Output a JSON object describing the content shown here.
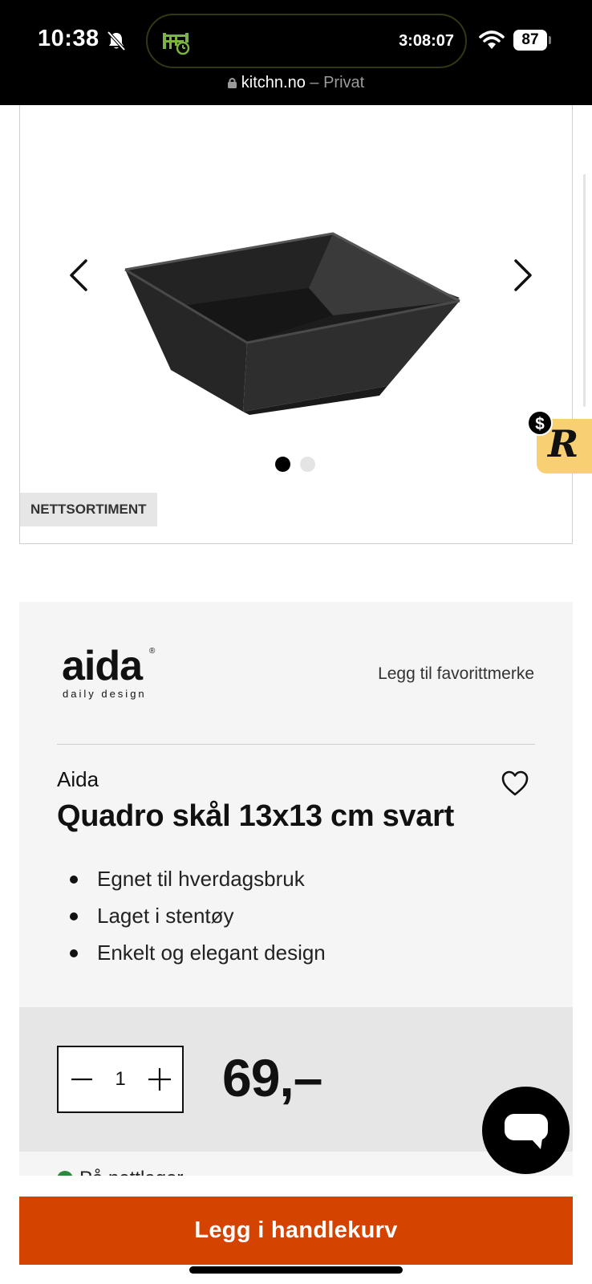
{
  "status_bar": {
    "time": "10:38",
    "timer": "3:08:07",
    "battery": "87",
    "bell_icon": "bell-slash-icon",
    "activity_icon": "timer-activity-icon",
    "wifi_icon": "wifi-icon"
  },
  "browser": {
    "domain": "kitchn.no",
    "separator": "–",
    "mode": "Privat",
    "lock_icon": "lock-icon"
  },
  "gallery": {
    "image_count": 2,
    "active_index": 0,
    "badge": "NETTSORTIMENT",
    "prev_icon": "chevron-left-icon",
    "next_icon": "chevron-right-icon"
  },
  "floating_badge": {
    "letter": "R",
    "symbol": "$",
    "color": "#f9cf73"
  },
  "product": {
    "logo_word": "aida",
    "logo_reg": "®",
    "logo_tagline": "daily design",
    "favorite_link": "Legg til favorittmerke",
    "brand": "Aida",
    "title": "Quadro skål 13x13 cm svart",
    "features": [
      "Egnet til hverdagsbruk",
      "Laget i stentøy",
      "Enkelt og elegant design"
    ]
  },
  "purchase": {
    "quantity": "1",
    "price": "69,–",
    "stock_text": "På nettlager"
  },
  "cart_button": {
    "label": "Legg i handlekurv",
    "color": "#d44400"
  }
}
